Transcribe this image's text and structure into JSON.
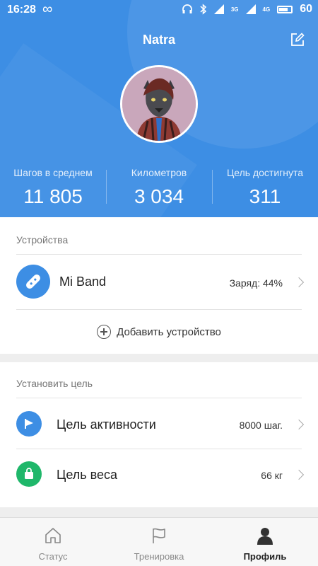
{
  "status_bar": {
    "time": "16:28",
    "infinity": "∞",
    "net_3g": "3G",
    "net_4g": "4G",
    "battery": "60"
  },
  "header": {
    "title": "Natra"
  },
  "stats": [
    {
      "label": "Шагов в среднем",
      "value": "11 805"
    },
    {
      "label": "Километров",
      "value": "3 034"
    },
    {
      "label": "Цель достигнута",
      "value": "311"
    }
  ],
  "devices": {
    "title": "Устройства",
    "items": [
      {
        "name": "Mi Band",
        "status": "Заряд: 44%",
        "icon": "band-icon"
      }
    ],
    "add_label": "Добавить устройство"
  },
  "goals": {
    "title": "Установить цель",
    "items": [
      {
        "name": "Цель активности",
        "value": "8000 шаг.",
        "icon": "flag-icon",
        "color": "#3d8ee4"
      },
      {
        "name": "Цель веса",
        "value": "66 кг",
        "icon": "weight-icon",
        "color": "#1fb76a"
      }
    ]
  },
  "nav": {
    "items": [
      {
        "label": "Статус",
        "icon": "home-icon",
        "active": false
      },
      {
        "label": "Тренировка",
        "icon": "flag-outline-icon",
        "active": false
      },
      {
        "label": "Профиль",
        "icon": "person-icon",
        "active": true
      }
    ]
  },
  "colors": {
    "accent": "#3d8ee4",
    "green": "#1fb76a"
  }
}
